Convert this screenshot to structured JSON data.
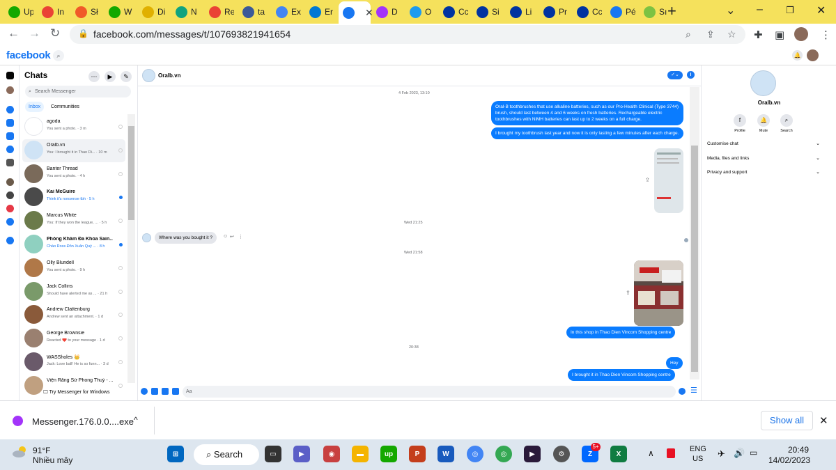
{
  "browser": {
    "tabs": [
      {
        "label": "Up",
        "color": "#14a800",
        "icon": "upwork-icon"
      },
      {
        "label": "In",
        "color": "#ea4335",
        "icon": "gmail-icon"
      },
      {
        "label": "Sł",
        "color": "#f05a28",
        "icon": "shop-icon"
      },
      {
        "label": "W",
        "color": "#14a800",
        "icon": "upwork-icon"
      },
      {
        "label": "Di",
        "color": "#e0b000",
        "icon": "smile-icon"
      },
      {
        "label": "N",
        "color": "#10a37f",
        "icon": "openai-icon"
      },
      {
        "label": "Re",
        "color": "#ea4335",
        "icon": "gmail-icon"
      },
      {
        "label": "ta",
        "color": "#3b5998",
        "icon": "image-icon"
      },
      {
        "label": "Ex",
        "color": "#4285f4",
        "icon": "drive-icon"
      },
      {
        "label": "Er",
        "color": "#0078d4",
        "icon": "outlook-icon"
      },
      {
        "label": "",
        "color": "#1877f2",
        "icon": "facebook-icon",
        "active": true
      },
      {
        "label": "D",
        "color": "#a334fa",
        "icon": "messenger-icon"
      },
      {
        "label": "O",
        "color": "#1d9bf0",
        "icon": "twitter-icon"
      },
      {
        "label": "Cc",
        "color": "#0033a0",
        "icon": "pg-icon"
      },
      {
        "label": "Si",
        "color": "#0033a0",
        "icon": "circle-icon"
      },
      {
        "label": "Li",
        "color": "#0033a0",
        "icon": "pg-icon"
      },
      {
        "label": "Pr",
        "color": "#0033a0",
        "icon": "pg-icon"
      },
      {
        "label": "Cc",
        "color": "#0033a0",
        "icon": "pg-icon"
      },
      {
        "label": "Pé",
        "color": "#1877f2",
        "icon": "facebook-icon"
      },
      {
        "label": "Sı",
        "color": "#7cc242",
        "icon": "leaf-icon"
      }
    ],
    "url": "facebook.com/messages/t/107693821941654"
  },
  "fb": {
    "logo": "facebook"
  },
  "chats": {
    "title": "Chats",
    "search_placeholder": "Search Messenger",
    "tab_inbox": "Inbox",
    "tab_communities": "Communities",
    "try": "Try Messenger for Windows",
    "items": [
      {
        "name": "agoda",
        "preview": "You sent a photo. · 3 m",
        "av": "#ffffff",
        "unread": false
      },
      {
        "name": "Oralb.vn",
        "preview": "You: I brought it in Thao Di... · 10 m",
        "av": "#cfe3f5",
        "unread": false
      },
      {
        "name": "Banter Thread",
        "preview": "You sent a photo. · 4 h",
        "av": "#7a6a5a",
        "unread": false
      },
      {
        "name": "Kai McGuire",
        "preview": "Think it's nonsense tbh · 5 h",
        "av": "#4a4a4a",
        "unread": true
      },
      {
        "name": "Marcus White",
        "preview": "You: If they won the league, ... · 5 h",
        "av": "#6b7a4a",
        "unread": false
      },
      {
        "name": "Phòng Khám Đa Khoa Sain...",
        "preview": "Chào Ross Đôn Xuân Quý ... · 8 h",
        "av": "#8fd0c0",
        "unread": true
      },
      {
        "name": "Olly Blundell",
        "preview": "You sent a photo. · 9 h",
        "av": "#b07848",
        "unread": false
      },
      {
        "name": "Jack Collins",
        "preview": "Should have alerted me as ... · 21 h",
        "av": "#7a9a6a",
        "unread": false
      },
      {
        "name": "Andrew Clattenburg",
        "preview": "Andrew sent an attachment. · 1 d",
        "av": "#8a5a3a",
        "unread": false
      },
      {
        "name": "George Brownsie",
        "preview": "Reacted ❤️ to your message · 1 d",
        "av": "#9a8070",
        "unread": false
      },
      {
        "name": "WASSholes 👑",
        "preview": "Jack: Love ball! He is so funn... · 3 d",
        "av": "#6a5a6a",
        "unread": false
      },
      {
        "name": "Viện Răng Sứ Phong Thuỷ - ...",
        "preview": "",
        "av": "#c0a080",
        "unread": false
      }
    ]
  },
  "convo": {
    "name": "Oralb.vn",
    "stamp1": "4 Feb 2023, 13:10",
    "msg1": "Oral-B toothbrushes that use alkaline batteries, such as our Pro-Health Clinical (Type 3744) brush, should last between 4 and 6 weeks on fresh batteries. Rechargeable electric toothbrushes with NiMH batteries can last up to 2 weeks on a full charge.",
    "msg2": "I brought my toothbrush last year and now it is only lasting a few minutes after each charge.",
    "stamp2": "Wed 21:25",
    "msg3": "Where was you bought it ?",
    "stamp3": "Wed 21:58",
    "msg4": "In this shop in Thao Dien Vincom Shopping centre",
    "stamp4": "20:38",
    "msg5": "Hey",
    "msg6": "I brought it in Thao Dien Vincom Shopping centre",
    "composer_placeholder": "Aa"
  },
  "info": {
    "name": "Oralb.vn",
    "profile": "Profile",
    "mute": "Mute",
    "search": "Search",
    "customise": "Customise chat",
    "media": "Media, files and links",
    "privacy": "Privacy and support"
  },
  "download": {
    "file": "Messenger.176.0.0....exe",
    "show_all": "Show all"
  },
  "taskbar": {
    "temp": "91°F",
    "condition": "Nhiều mây",
    "search": "Search",
    "lang1": "ENG",
    "lang2": "US",
    "time": "20:49",
    "date": "14/02/2023",
    "zalo_badge": "5+"
  }
}
